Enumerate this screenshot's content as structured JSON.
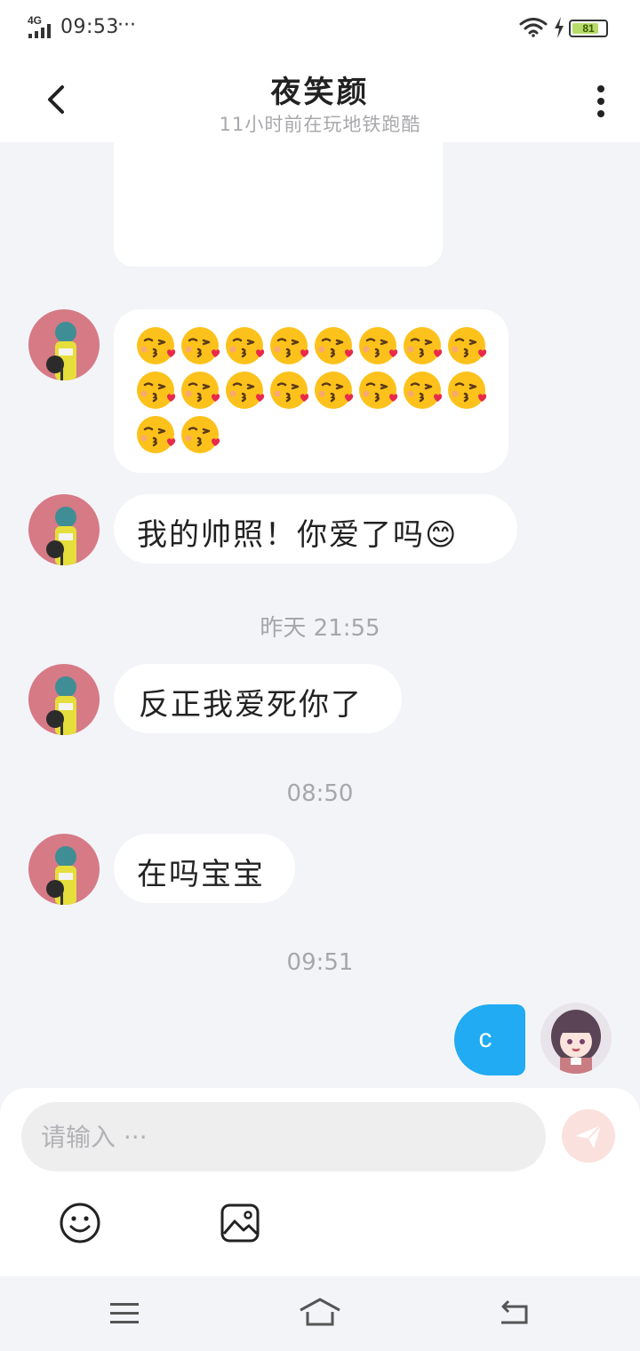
{
  "status_bar": {
    "network": "4G",
    "time": "09:53",
    "dots": "···",
    "battery_level": 81,
    "battery_label": "81"
  },
  "header": {
    "title": "夜笑颜",
    "subtitle": "11小时前在玩地铁跑酷"
  },
  "messages": [
    {
      "sender": "other",
      "type": "emoji",
      "emoji": "kissing-face-heart",
      "count": 18
    },
    {
      "sender": "other",
      "type": "text",
      "text": "我的帅照！你爱了吗😊"
    },
    {
      "type": "timestamp",
      "text": "昨天 21:55"
    },
    {
      "sender": "other",
      "type": "text",
      "text": "反正我爱死你了"
    },
    {
      "type": "timestamp",
      "text": "08:50"
    },
    {
      "sender": "other",
      "type": "text",
      "text": "在吗宝宝"
    },
    {
      "type": "timestamp",
      "text": "09:51"
    },
    {
      "sender": "me",
      "type": "text",
      "text": "c"
    }
  ],
  "input": {
    "placeholder": "请输入 ···"
  },
  "icons": {
    "send": "paper-plane-icon",
    "emoji": "smiley-face-icon",
    "image": "image-icon",
    "back": "chevron-left-icon",
    "more": "more-vertical-icon"
  },
  "colors": {
    "accent": "#21abf2",
    "background": "#f3f4f8",
    "send_disabled": "#fbe1dd",
    "battery": "#b7dc6a"
  }
}
